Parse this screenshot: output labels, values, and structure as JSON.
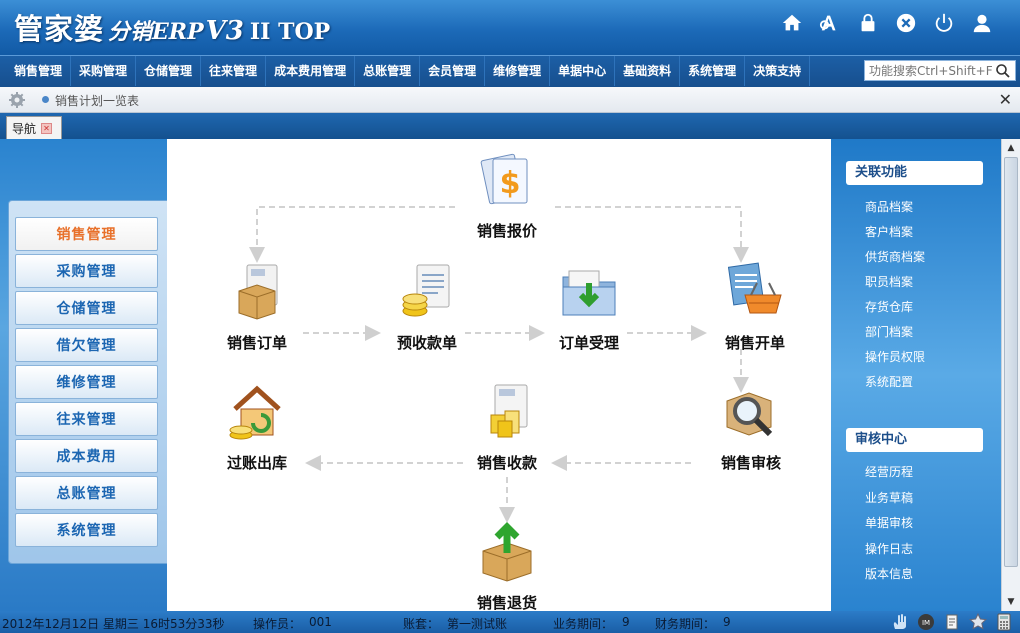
{
  "app": {
    "logo_main": "管家婆",
    "logo_sub": "分销ERP",
    "logo_version": "V3",
    "logo_edition": "II TOP"
  },
  "title_icons": [
    "home-icon",
    "font-size-icon",
    "lock-icon",
    "close-circle-icon",
    "power-icon",
    "user-icon"
  ],
  "menu": {
    "items": [
      "销售管理",
      "采购管理",
      "仓储管理",
      "往来管理",
      "成本费用管理",
      "总账管理",
      "会员管理",
      "维修管理",
      "单据中心",
      "基础资料",
      "系统管理",
      "决策支持"
    ],
    "search_placeholder": "功能搜索Ctrl+Shift+F"
  },
  "breadcrumb": {
    "text": "销售计划一览表"
  },
  "tabs": [
    {
      "label": "导航"
    }
  ],
  "left_nav": {
    "items": [
      "销售管理",
      "采购管理",
      "仓储管理",
      "借欠管理",
      "维修管理",
      "往来管理",
      "成本费用",
      "总账管理",
      "系统管理"
    ],
    "active_index": 0
  },
  "workflow": {
    "nodes": {
      "quote": "销售报价",
      "order": "销售订单",
      "prepay": "预收款单",
      "accept": "订单受理",
      "invoice": "销售开单",
      "post": "过账出库",
      "receive": "销售收款",
      "audit": "销售审核",
      "return": "销售退货"
    }
  },
  "right_panel": {
    "related_title": "关联功能",
    "related_links": [
      "商品档案",
      "客户档案",
      "供货商档案",
      "职员档案",
      "存货仓库",
      "部门档案",
      "操作员权限",
      "系统配置"
    ],
    "audit_title": "审核中心",
    "audit_links": [
      "经营历程",
      "业务草稿",
      "单据审核",
      "操作日志",
      "版本信息"
    ]
  },
  "status": {
    "datetime": "2012年12月12日 星期三 16时53分33秒",
    "operator_label": "操作员：",
    "operator_value": "001",
    "account_label": "账套：",
    "account_value": "第一测试账",
    "biz_period_label": "业务期间：",
    "biz_period_value": "9",
    "fin_period_label": "财务期间：",
    "fin_period_value": "9"
  },
  "colors": {
    "brand_blue": "#1c6ab8",
    "active_nav": "#e8702a",
    "nav_text": "#1c66b2"
  }
}
